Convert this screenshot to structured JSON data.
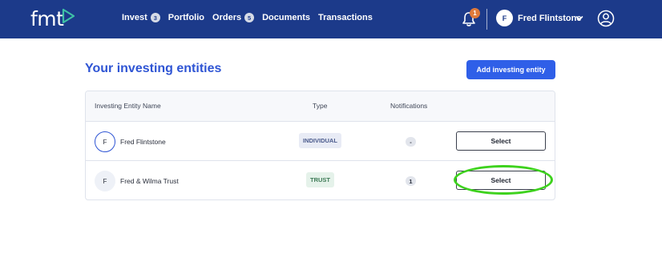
{
  "brand": {
    "logo_text": "fmt"
  },
  "nav": {
    "items": [
      {
        "label": "Invest",
        "badge": "3"
      },
      {
        "label": "Portfolio"
      },
      {
        "label": "Orders",
        "badge": "5"
      },
      {
        "label": "Documents"
      },
      {
        "label": "Transactions"
      }
    ]
  },
  "header": {
    "notification_count": "1",
    "user_initial": "F",
    "user_name": "Fred Flintstone"
  },
  "page": {
    "title": "Your investing entities",
    "add_button_label": "Add investing entity"
  },
  "table": {
    "columns": {
      "name": "Investing Entity Name",
      "type": "Type",
      "notifications": "Notifications"
    },
    "rows": [
      {
        "initial": "F",
        "name": "Fred Flintstone",
        "type": "INDIVIDUAL",
        "notifications": "-",
        "action": "Select"
      },
      {
        "initial": "F",
        "name": "Fred & Wilma Trust",
        "type": "TRUST",
        "notifications": "1",
        "action": "Select"
      }
    ]
  },
  "colors": {
    "header_bg": "#1c3a8a",
    "accent": "#2f5fe8",
    "logo_accent": "#3ec1a6",
    "notification_badge": "#e07a3a",
    "highlight": "#3ed21e"
  }
}
